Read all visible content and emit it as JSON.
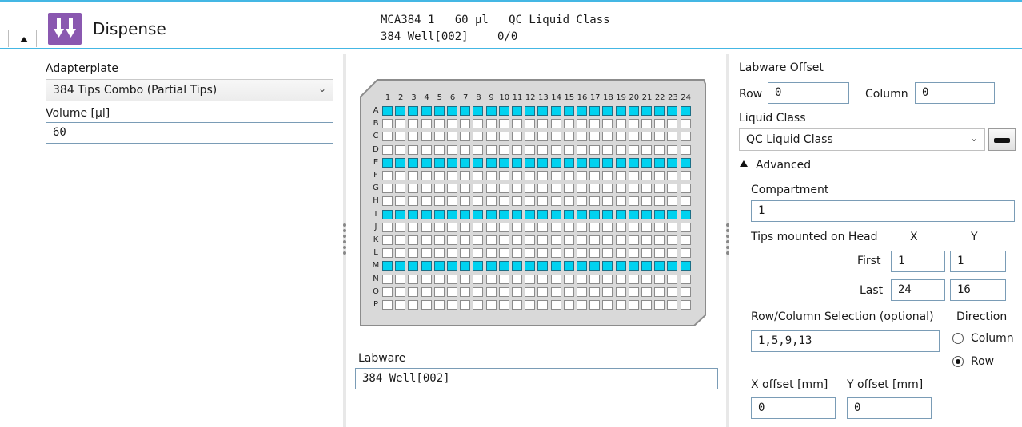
{
  "header": {
    "title": "Dispense",
    "summary_line1": "MCA384 1   60 µl   QC Liquid Class",
    "summary_line2_left": "384 Well[002]",
    "summary_line2_right": "0/0"
  },
  "left": {
    "adapterplate_label": "Adapterplate",
    "adapterplate_value": "384 Tips Combo (Partial Tips)",
    "volume_label": "Volume [µl]",
    "volume_value": "60"
  },
  "plate": {
    "columns": [
      "1",
      "2",
      "3",
      "4",
      "5",
      "6",
      "7",
      "8",
      "9",
      "10",
      "11",
      "12",
      "13",
      "14",
      "15",
      "16",
      "17",
      "18",
      "19",
      "20",
      "21",
      "22",
      "23",
      "24"
    ],
    "rows": [
      "A",
      "B",
      "C",
      "D",
      "E",
      "F",
      "G",
      "H",
      "I",
      "J",
      "K",
      "L",
      "M",
      "N",
      "O",
      "P"
    ],
    "selected_rows": [
      "A",
      "E",
      "I",
      "M"
    ],
    "selected_color": "#00d2f0"
  },
  "labware": {
    "label": "Labware",
    "value": "384 Well[002]"
  },
  "right": {
    "labware_offset_label": "Labware Offset",
    "row_label": "Row",
    "row_value": "0",
    "column_label": "Column",
    "column_value": "0",
    "liquid_class_label": "Liquid Class",
    "liquid_class_value": "QC Liquid Class",
    "advanced_label": "Advanced",
    "compartment_label": "Compartment",
    "compartment_value": "1",
    "tips_label": "Tips mounted on Head",
    "x_label": "X",
    "y_label": "Y",
    "first_label": "First",
    "first_x": "1",
    "first_y": "1",
    "last_label": "Last",
    "last_x": "24",
    "last_y": "16",
    "selection_label": "Row/Column Selection (optional)",
    "selection_value": "1,5,9,13",
    "direction_label": "Direction",
    "direction_options": [
      "Column",
      "Row"
    ],
    "direction_selected": "Row",
    "x_offset_label": "X offset [mm]",
    "x_offset_value": "0",
    "y_offset_label": "Y offset [mm]",
    "y_offset_value": "0"
  }
}
